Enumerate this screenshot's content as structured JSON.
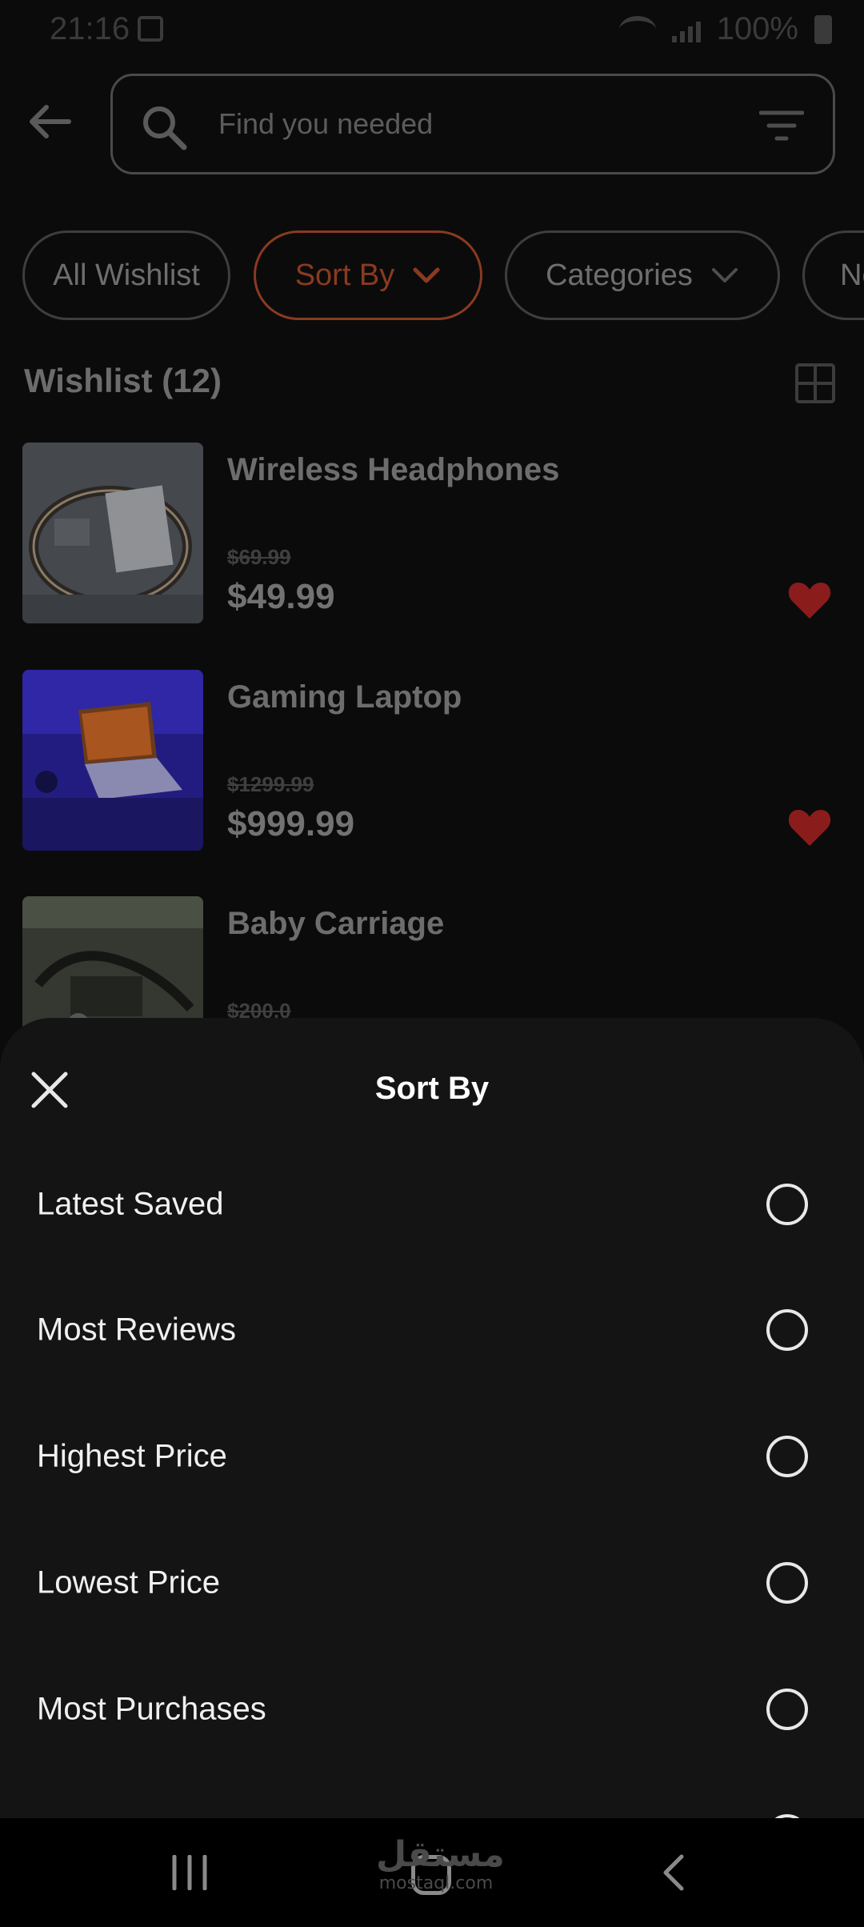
{
  "status_bar": {
    "time": "21:16",
    "battery": "100%"
  },
  "search": {
    "placeholder": "Find you needed"
  },
  "chips": [
    {
      "label": "All Wishlist"
    },
    {
      "label": "Sort By"
    },
    {
      "label": "Categories"
    },
    {
      "label": "Ne"
    }
  ],
  "wishlist": {
    "title": "Wishlist (12)",
    "products": [
      {
        "name": "Wireless Headphones",
        "old_price": "$69.99",
        "price": "$49.99",
        "favorited": true
      },
      {
        "name": "Gaming Laptop",
        "old_price": "$1299.99",
        "price": "$999.99",
        "favorited": true
      },
      {
        "name": "Baby Carriage",
        "old_price": "$200.0",
        "price": "",
        "favorited": false
      }
    ]
  },
  "sort_sheet": {
    "title": "Sort By",
    "options": [
      {
        "label": "Latest Saved",
        "selected": false
      },
      {
        "label": "Most Reviews",
        "selected": false
      },
      {
        "label": "Highest Price",
        "selected": false
      },
      {
        "label": "Lowest Price",
        "selected": false
      },
      {
        "label": "Most Purchases",
        "selected": false
      }
    ]
  },
  "watermark": {
    "arabic": "مستقل",
    "latin": "mostaql.com"
  },
  "colors": {
    "accent": "#e8643c",
    "heart": "#8b1c1c",
    "sheet_bg": "#141414",
    "page_bg": "#0b0b0b"
  }
}
